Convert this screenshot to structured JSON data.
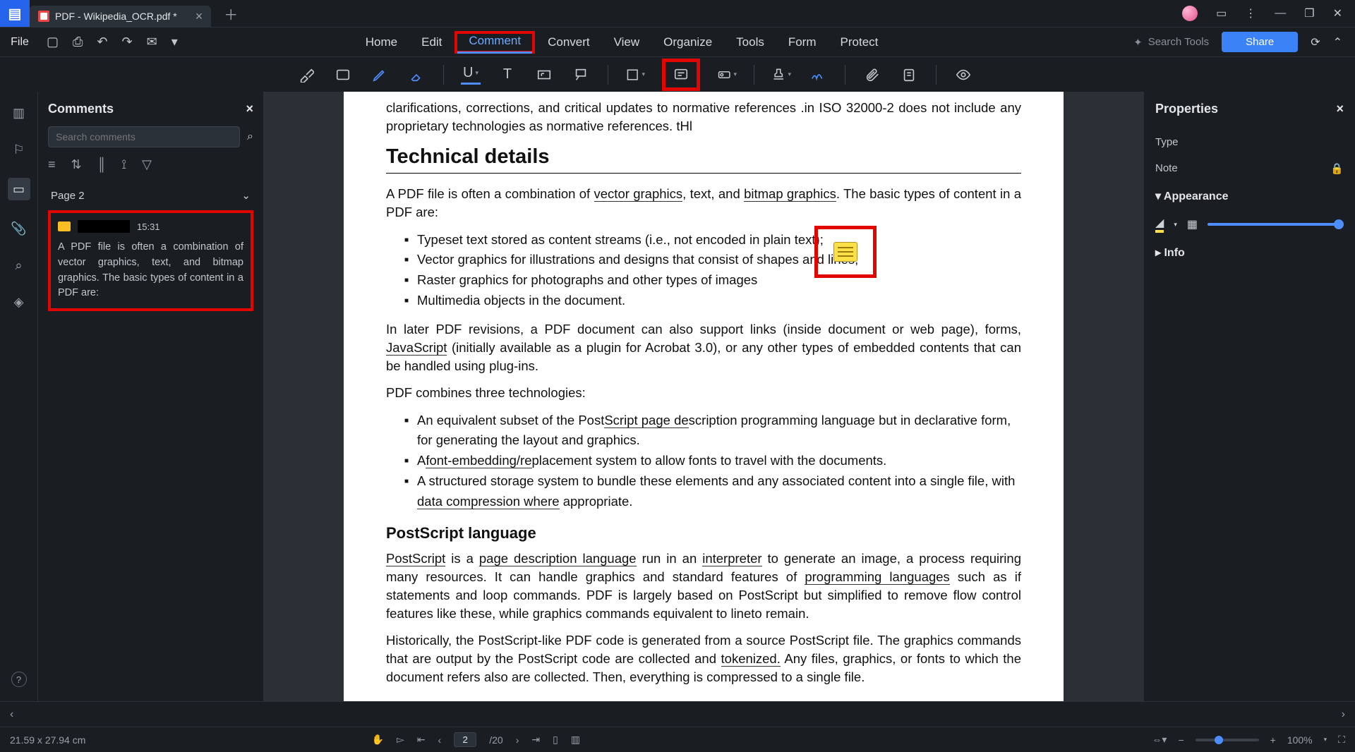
{
  "titlebar": {
    "tab_title": "PDF - Wikipedia_OCR.pdf *"
  },
  "menubar": {
    "file": "File",
    "items": [
      "Home",
      "Edit",
      "Comment",
      "Convert",
      "View",
      "Organize",
      "Tools",
      "Form",
      "Protect"
    ],
    "active_index": 2,
    "highlight_index": 2,
    "search_placeholder": "Search Tools",
    "share": "Share"
  },
  "comments_panel": {
    "title": "Comments",
    "search_placeholder": "Search comments",
    "page_header": "Page 2",
    "card": {
      "time": "15:31",
      "body": "A PDF file is often a combination of vector graphics, text, and bitmap graphics. The basic types  of content in a PDF are:"
    }
  },
  "document": {
    "frag_top": "clarifications, corrections, and critical updates to normative references .in ISO 32000-2 does not include any proprietary technologies as normative references. tHl",
    "h_tech": "Technical details",
    "p1a": "A PDF file is often a combination of ",
    "p1_link1": "vector graphics",
    "p1b": ", text, and ",
    "p1_link2": "bitmap graphics",
    "p1c": ". The basic types of content in a PDF are:",
    "li1": "Typeset text stored as content streams (i.e., not encoded in plain text);",
    "li2": "Vector graphics for illustrations and designs that consist of shapes and lines;",
    "li3": "Raster graphics for photographs and other types of images",
    "li4": "Multimedia objects in the document.",
    "p2a": "In later PDF revisions, a PDF document can also support links (inside document or web page), forms, ",
    "p2_link1": "JavaScript",
    "p2b": " (initially available as a plugin for Acrobat 3.0), or any other types of embedded contents that can be handled using plug-ins.",
    "p3": "PDF combines three technologies:",
    "li5a": "An equivalent subset of the Post",
    "li5_link": "Script page de",
    "li5b": "scription programming language but in declarative form, for generating the layout and graphics.",
    "li6a": "A",
    "li6_link": "font-embedding/re",
    "li6b": "placement system to allow fonts to travel with the documents.",
    "li7a": "A structured storage system to bundle these elements and any associated content into a single file, with ",
    "li7_link": "data compression where",
    "li7b": " appropriate.",
    "h_ps": "PostScript language",
    "p4_link1": "PostScript",
    "p4a": " is a ",
    "p4_link2": "page description language",
    "p4b": " run in an ",
    "p4_link3": "interpreter",
    "p4c": " to generate an image, a process requiring many resources. It can handle graphics and standard features of ",
    "p4_link4": "programming languages",
    "p4d": " such as if statements and loop commands. PDF is largely based on PostScript but simplified to remove flow control features like these, while graphics commands equivalent to lineto remain.",
    "p5a": "Historically, the PostScript-like PDF code is generated from a source PostScript file. The graphics commands that are output by the PostScript code are collected and ",
    "p5_link": "tokenized.",
    "p5b": " Any files, graphics, or fonts to which the document refers also are collected. Then, everything is compressed to a single file."
  },
  "properties": {
    "title": "Properties",
    "type_label": "Type",
    "note_label": "Note",
    "appearance": "Appearance",
    "info": "Info"
  },
  "status": {
    "dims": "21.59 x 27.94 cm",
    "page_current": "2",
    "page_total": "/20",
    "zoom": "100%"
  }
}
